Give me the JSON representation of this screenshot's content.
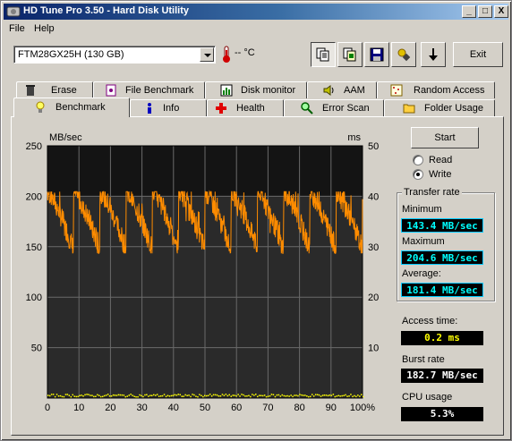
{
  "window": {
    "title": "HD Tune Pro 3.50 - Hard Disk Utility",
    "min": "_",
    "max": "□",
    "close": "X"
  },
  "menu": {
    "file": "File",
    "help": "Help"
  },
  "toolbar": {
    "drive": "FTM28GX25H (130 GB)",
    "temp": "-- °C",
    "exit_label": "Exit",
    "icons": [
      "copy-text-icon",
      "copy-screen-icon",
      "save-icon",
      "options-icon",
      "download-icon"
    ]
  },
  "tabs_row1": [
    {
      "label": "Erase",
      "icon": "trash-icon"
    },
    {
      "label": "File Benchmark",
      "icon": "file-benchmark-icon"
    },
    {
      "label": "Disk monitor",
      "icon": "disk-monitor-icon"
    },
    {
      "label": "AAM",
      "icon": "speaker-icon"
    },
    {
      "label": "Random Access",
      "icon": "random-access-icon"
    }
  ],
  "tabs_row2": [
    {
      "label": "Benchmark",
      "icon": "lightbulb-icon",
      "active": true
    },
    {
      "label": "Info",
      "icon": "info-icon"
    },
    {
      "label": "Health",
      "icon": "health-cross-icon"
    },
    {
      "label": "Error Scan",
      "icon": "magnifier-icon"
    },
    {
      "label": "Folder Usage",
      "icon": "folder-icon"
    }
  ],
  "controls": {
    "start_label": "Start",
    "read_label": "Read",
    "write_label": "Write",
    "selected_mode": "Write"
  },
  "transfer_rate": {
    "title": "Transfer rate",
    "minimum_label": "Minimum",
    "minimum_value": "143.4 MB/sec",
    "maximum_label": "Maximum",
    "maximum_value": "204.6 MB/sec",
    "average_label": "Average:",
    "average_value": "181.4 MB/sec"
  },
  "stats": {
    "access_label": "Access time:",
    "access_value": "0.2 ms",
    "burst_label": "Burst rate",
    "burst_value": "182.7 MB/sec",
    "cpu_label": "CPU usage",
    "cpu_value": "5.3%"
  },
  "colors": {
    "series_transfer": "#ff8c00",
    "series_access": "#ffff00",
    "plot_bg": "#1a1a1a",
    "grid": "#ffffff"
  },
  "chart_data": {
    "type": "line",
    "left_unit": "MB/sec",
    "right_unit": "ms",
    "ylim_left": [
      0,
      250
    ],
    "ylim_right": [
      0,
      50
    ],
    "left_ticks": [
      "250",
      "200",
      "150",
      "100",
      "50"
    ],
    "right_ticks": [
      "50",
      "40",
      "30",
      "20",
      "10"
    ],
    "x_ticks": [
      "0",
      "10",
      "20",
      "30",
      "40",
      "50",
      "60",
      "70",
      "80",
      "90",
      "100%"
    ],
    "grid": true,
    "series": [
      {
        "name": "Transfer rate",
        "color": "#ff8c00",
        "pattern": "sawtooth",
        "min": 143.4,
        "max": 204.6,
        "avg": 181.4,
        "periods": 12
      },
      {
        "name": "Access time",
        "color": "#ffff00",
        "values_ms_approx": 0.2
      }
    ]
  }
}
